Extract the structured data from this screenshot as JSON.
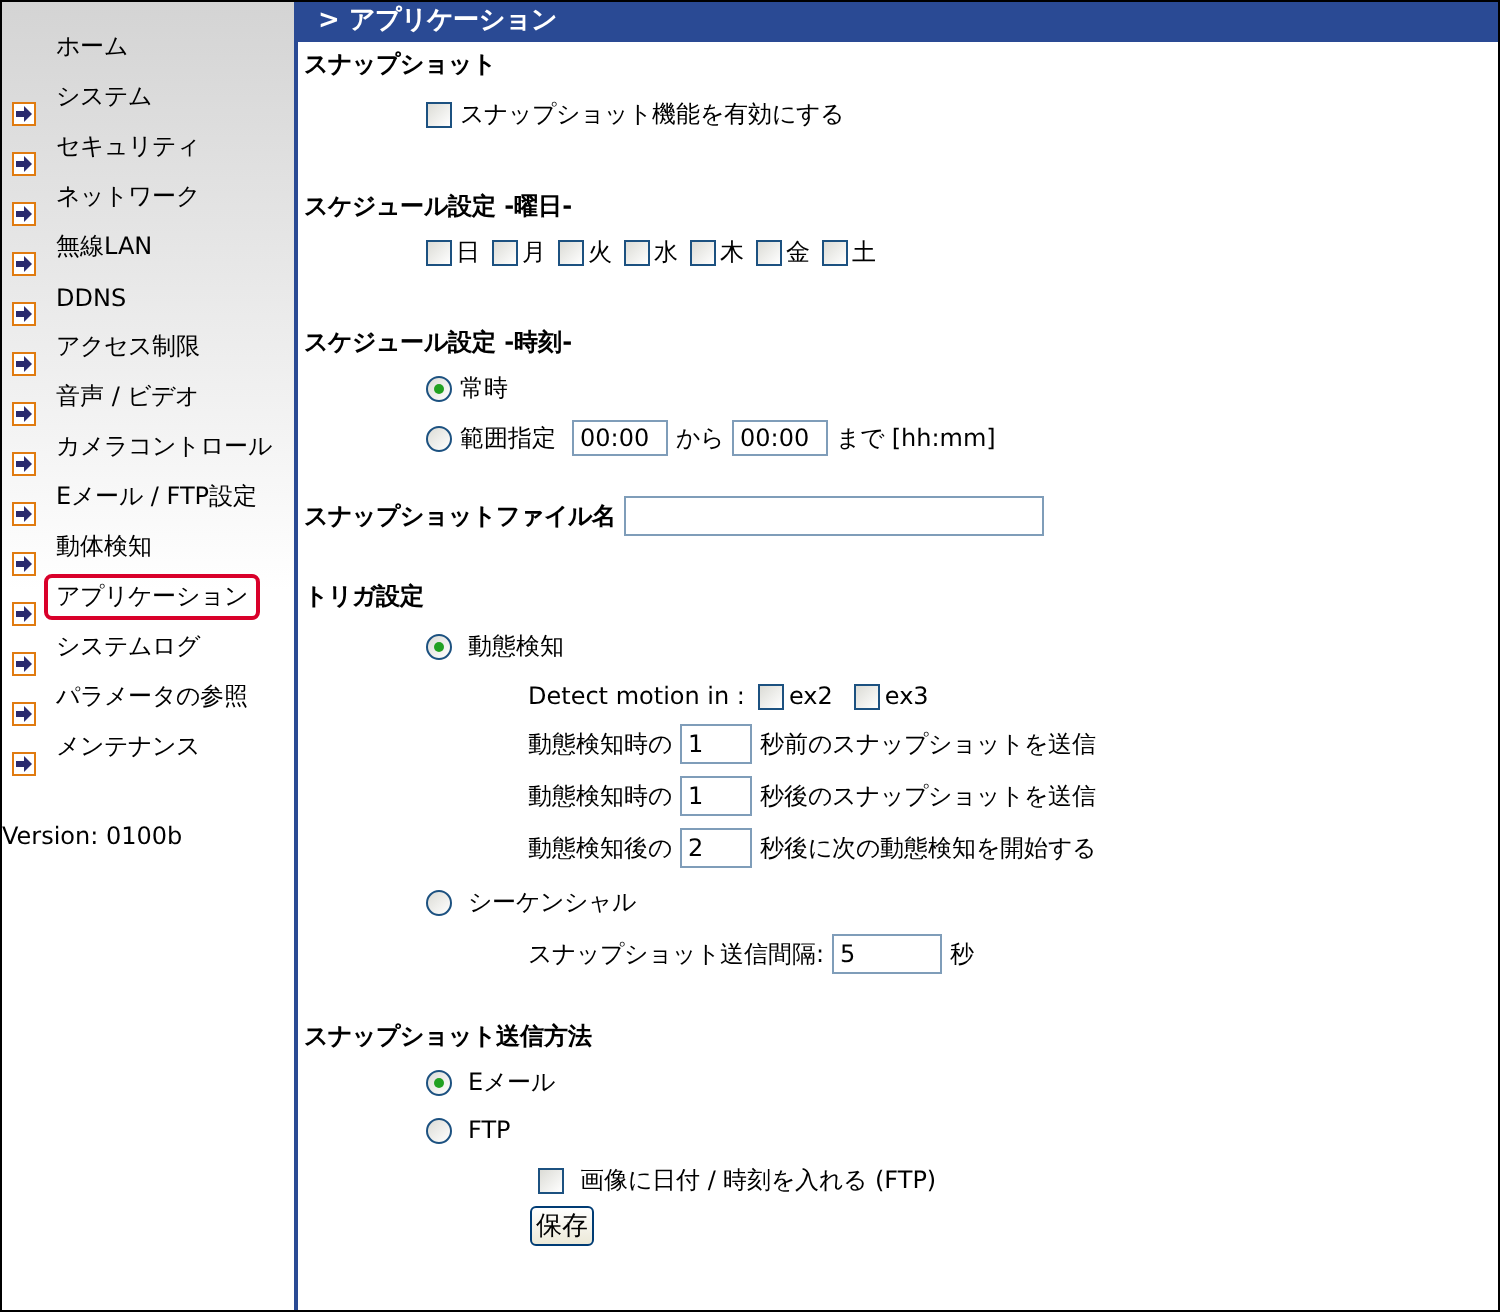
{
  "sidebar": {
    "items": [
      {
        "label": "ホーム",
        "arrow": false,
        "selected": false
      },
      {
        "label": "システム",
        "arrow": true,
        "selected": false
      },
      {
        "label": "セキュリティ",
        "arrow": true,
        "selected": false
      },
      {
        "label": "ネットワーク",
        "arrow": true,
        "selected": false
      },
      {
        "label": "無線LAN",
        "arrow": true,
        "selected": false
      },
      {
        "label": "DDNS",
        "arrow": true,
        "selected": false
      },
      {
        "label": "アクセス制限",
        "arrow": true,
        "selected": false
      },
      {
        "label": "音声 / ビデオ",
        "arrow": true,
        "selected": false
      },
      {
        "label": "カメラコントロール",
        "arrow": true,
        "selected": false
      },
      {
        "label": "Eメール / FTP設定",
        "arrow": true,
        "selected": false
      },
      {
        "label": "動体検知",
        "arrow": true,
        "selected": false
      },
      {
        "label": "アプリケーション",
        "arrow": true,
        "selected": true
      },
      {
        "label": "システムログ",
        "arrow": true,
        "selected": false
      },
      {
        "label": "パラメータの参照",
        "arrow": true,
        "selected": false
      },
      {
        "label": "メンテナンス",
        "arrow": true,
        "selected": false
      }
    ],
    "version": "Version: 0100b"
  },
  "header": {
    "title": "> アプリケーション"
  },
  "snapshot": {
    "heading": "スナップショット",
    "enable": {
      "label": "スナップショット機能を有効にする",
      "checked": false
    }
  },
  "schedule_days": {
    "heading": "スケジュール設定 -曜日-",
    "days": [
      {
        "label": "日",
        "checked": false
      },
      {
        "label": "月",
        "checked": false
      },
      {
        "label": "火",
        "checked": false
      },
      {
        "label": "水",
        "checked": false
      },
      {
        "label": "木",
        "checked": false
      },
      {
        "label": "金",
        "checked": false
      },
      {
        "label": "土",
        "checked": false
      }
    ]
  },
  "schedule_time": {
    "heading": "スケジュール設定 -時刻-",
    "always": {
      "label": "常時",
      "selected": true
    },
    "range": {
      "label": "範囲指定",
      "selected": false,
      "from": "00:00",
      "from_label": "から",
      "to": "00:00",
      "to_label": "まで [hh:mm]"
    }
  },
  "filename": {
    "label": "スナップショットファイル名"
  },
  "trigger": {
    "heading": "トリガ設定",
    "motion": {
      "label": "動態検知",
      "selected": true
    },
    "detect": {
      "label": "Detect motion in :",
      "options": [
        {
          "label": "ex2",
          "checked": false
        },
        {
          "label": "ex3",
          "checked": false
        }
      ]
    },
    "rows": [
      {
        "prefix": "動態検知時の",
        "value": "1",
        "suffix": "秒前のスナップショットを送信"
      },
      {
        "prefix": "動態検知時の",
        "value": "1",
        "suffix": "秒後のスナップショットを送信"
      },
      {
        "prefix": "動態検知後の",
        "value": "2",
        "suffix": "秒後に次の動態検知を開始する"
      }
    ],
    "sequential": {
      "label": "シーケンシャル",
      "selected": false
    },
    "interval": {
      "label": "スナップショット送信間隔:",
      "value": "5",
      "unit": "秒"
    }
  },
  "send": {
    "heading": "スナップショット送信方法",
    "methods": [
      {
        "label": "Eメール",
        "selected": true
      },
      {
        "label": "FTP",
        "selected": false
      }
    ],
    "stamp": {
      "label": "画像に日付 / 時刻を入れる (FTP)",
      "checked": false
    },
    "save": "保存"
  }
}
